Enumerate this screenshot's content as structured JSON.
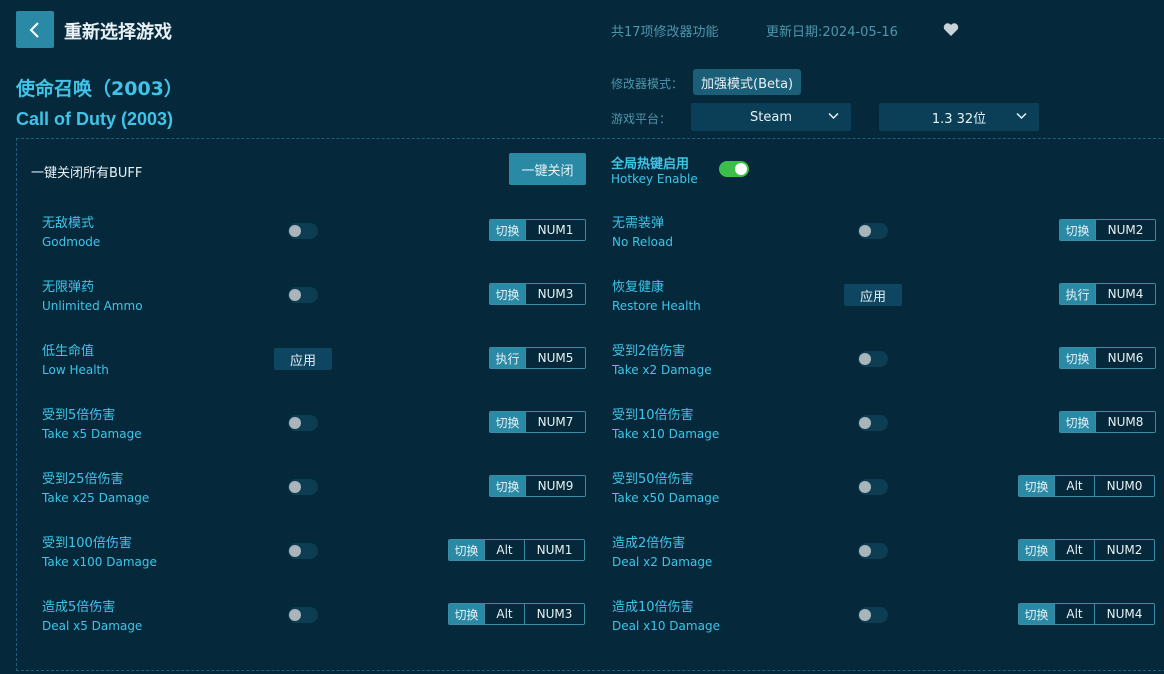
{
  "header": {
    "title": "重新选择游戏",
    "feature_count": "共17项修改器功能",
    "update_date": "更新日期:2024-05-16"
  },
  "game": {
    "name_cn": "使命召唤（2003）",
    "name_en": "Call of Duty (2003)"
  },
  "meta": {
    "mode_label": "修改器模式：",
    "mode_value": "加强模式(Beta)",
    "platform_label": "游戏平台：",
    "platform_value": "Steam",
    "version_value": "1.3 32位"
  },
  "controls": {
    "all_off_label": "一键关闭所有BUFF",
    "all_off_button": "一键关闭",
    "hotkey_cn": "全局热键启用",
    "hotkey_en": "Hotkey Enable",
    "apply_label": "应用"
  },
  "features_left": [
    {
      "cn": "无敌模式",
      "en": "Godmode",
      "control": "toggle",
      "action": "切换",
      "keys": [
        "NUM1"
      ]
    },
    {
      "cn": "无限弹药",
      "en": "Unlimited Ammo",
      "control": "toggle",
      "action": "切换",
      "keys": [
        "NUM3"
      ]
    },
    {
      "cn": "低生命值",
      "en": "Low Health",
      "control": "apply",
      "action": "执行",
      "keys": [
        "NUM5"
      ]
    },
    {
      "cn": "受到5倍伤害",
      "en": "Take x5 Damage",
      "control": "toggle",
      "action": "切换",
      "keys": [
        "NUM7"
      ]
    },
    {
      "cn": "受到25倍伤害",
      "en": "Take x25 Damage",
      "control": "toggle",
      "action": "切换",
      "keys": [
        "NUM9"
      ]
    },
    {
      "cn": "受到100倍伤害",
      "en": "Take x100 Damage",
      "control": "toggle",
      "action": "切换",
      "keys": [
        "Alt",
        "NUM1"
      ]
    },
    {
      "cn": "造成5倍伤害",
      "en": "Deal x5 Damage",
      "control": "toggle",
      "action": "切换",
      "keys": [
        "Alt",
        "NUM3"
      ]
    }
  ],
  "features_right": [
    {
      "cn": "无需装弹",
      "en": "No Reload",
      "control": "toggle",
      "action": "切换",
      "keys": [
        "NUM2"
      ]
    },
    {
      "cn": "恢复健康",
      "en": "Restore Health",
      "control": "apply",
      "action": "执行",
      "keys": [
        "NUM4"
      ]
    },
    {
      "cn": "受到2倍伤害",
      "en": "Take x2 Damage",
      "control": "toggle",
      "action": "切换",
      "keys": [
        "NUM6"
      ]
    },
    {
      "cn": "受到10倍伤害",
      "en": "Take x10 Damage",
      "control": "toggle",
      "action": "切换",
      "keys": [
        "NUM8"
      ]
    },
    {
      "cn": "受到50倍伤害",
      "en": "Take x50 Damage",
      "control": "toggle",
      "action": "切换",
      "keys": [
        "Alt",
        "NUM0"
      ]
    },
    {
      "cn": "造成2倍伤害",
      "en": "Deal x2 Damage",
      "control": "toggle",
      "action": "切换",
      "keys": [
        "Alt",
        "NUM2"
      ]
    },
    {
      "cn": "造成10倍伤害",
      "en": "Deal x10 Damage",
      "control": "toggle",
      "action": "切换",
      "keys": [
        "Alt",
        "NUM4"
      ]
    }
  ],
  "colors": {
    "background": "#05293b",
    "accent": "#2a8aa6",
    "label_cyan": "#3fc4e8",
    "toggle_on": "#3cbf4a"
  },
  "icons": {
    "back": "chevron-left-icon",
    "favorite": "heart-icon",
    "dropdown": "chevron-down-icon"
  }
}
